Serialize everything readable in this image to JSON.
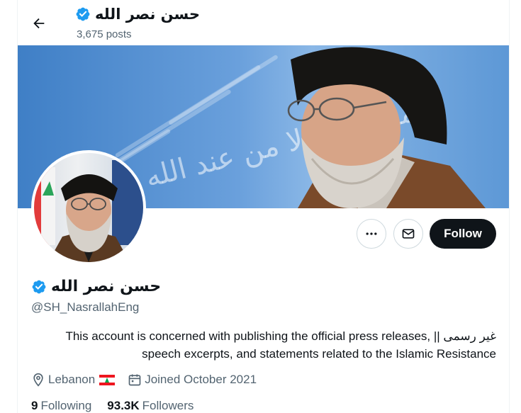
{
  "header": {
    "name": "حسن نصر الله",
    "posts": "3,675 posts"
  },
  "banner": {
    "calligraphy": "وما النصر إلا من عند الله"
  },
  "actions": {
    "follow_label": "Follow"
  },
  "profile": {
    "display_name": "حسن نصر الله",
    "handle": "@SH_NasrallahEng",
    "bio_line1": "This account is concerned with publishing the official press releases, || غير رسمى",
    "bio_line2": "speech excerpts, and statements related to the Islamic Resistance",
    "location": "Lebanon",
    "joined": "Joined October 2021",
    "following_count": "9",
    "following_label": "Following",
    "followers_count": "93.3K",
    "followers_label": "Followers"
  },
  "icons": {
    "back": "back-arrow-icon",
    "verified": "verified-badge-icon",
    "more": "more-icon",
    "message": "envelope-icon",
    "location": "location-pin-icon",
    "calendar": "calendar-icon",
    "flag": "lebanon-flag-icon"
  },
  "colors": {
    "verified": "#1d9bf0",
    "follow_bg": "#0f1419",
    "secondary_text": "#536471",
    "banner": "#5d98d6"
  }
}
